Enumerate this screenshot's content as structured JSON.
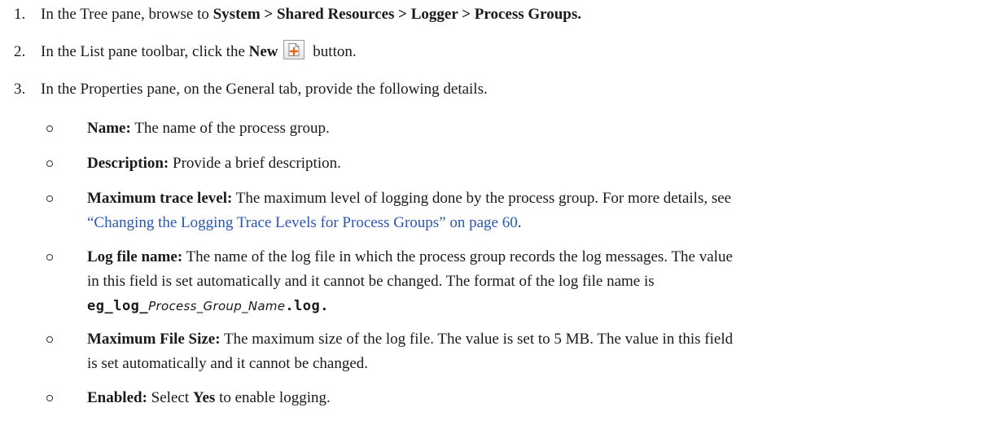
{
  "steps": [
    {
      "number": "1.",
      "prefix": "In the Tree pane, browse to ",
      "bold": "System > Shared Resources > Logger > Process Groups."
    },
    {
      "number": "2.",
      "prefix": "In the List pane toolbar, click the ",
      "bold": "New",
      "suffix": " button.",
      "icon": "new-document-plus-icon",
      "icon_color": "#e8631a"
    },
    {
      "number": "3.",
      "text": "In the Properties pane, on the General tab, provide the following details."
    }
  ],
  "fields": [
    {
      "label": "Name:",
      "text": " The name of the process group."
    },
    {
      "label": "Description:",
      "text": " Provide a brief description."
    },
    {
      "label": "Maximum trace level:",
      "text": " The maximum level of logging done by the process group. For more details, see",
      "link": "“Changing the Logging Trace Levels for Process Groups” on page 60",
      "link_suffix": ".",
      "link_color": "#2a56b4"
    },
    {
      "label": "Log file name:",
      "text": " The name of the log file in which the process group records the log messages. The value",
      "line2": "in this field is set automatically and it cannot be changed. The format of the log file name is",
      "code_prefix": "eg_log_",
      "code_var": "Process_Group_Name",
      "code_suffix": ".log."
    },
    {
      "label": "Maximum File Size:",
      "text": " The maximum size of the log file. The value is set to 5 MB. The value in this field",
      "line2": "is set automatically and it cannot be changed."
    },
    {
      "label": "Enabled:",
      "text": " Select ",
      "bold2": "Yes",
      "text2": " to enable logging."
    }
  ]
}
